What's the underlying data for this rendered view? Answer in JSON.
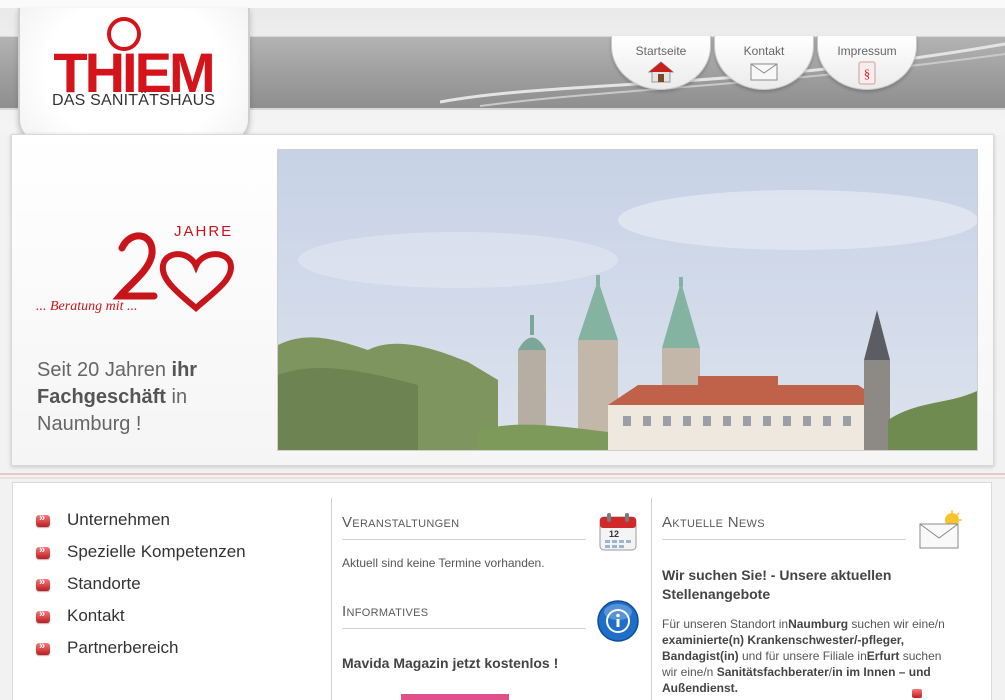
{
  "header": {
    "logo_text": "THIEM",
    "logo_subtitle": "DAS SANITÄTSHAUS",
    "nav": [
      {
        "label": "Startseite",
        "icon": "house-icon"
      },
      {
        "label": "Kontakt",
        "icon": "envelope-icon"
      },
      {
        "label": "Impressum",
        "icon": "paragraph-icon"
      }
    ]
  },
  "hero": {
    "anniversary": {
      "jahre": "JAHRE",
      "number": "20",
      "slogan": "... Beratung mit ..."
    },
    "text_part1": "Seit 20 Jahren ",
    "text_bold1": "ihr Fachgeschäft",
    "text_part2": " in Naumburg !"
  },
  "sidebar": {
    "items": [
      {
        "label": "Unternehmen"
      },
      {
        "label": "Spezielle Kompetenzen"
      },
      {
        "label": "Standorte"
      },
      {
        "label": "Kontakt"
      },
      {
        "label": "Partnerbereich"
      }
    ]
  },
  "events": {
    "title": "Veranstaltungen",
    "icon": "calendar-icon",
    "calendar_day": "12",
    "text": "Aktuell sind keine Termine vorhanden."
  },
  "info": {
    "title": "Informatives",
    "icon": "info-icon",
    "headline": "Mavida Magazin jetzt kostenlos !"
  },
  "news": {
    "title": "Aktuelle News",
    "icon": "mail-sun-icon",
    "headline": "Wir suchen Sie! - Unsere aktuellen Stellenangebote",
    "p1": "Für unseren Standort in",
    "b1": "Naumburg",
    "p2": " suchen wir eine/n ",
    "b2": "examinierte(n) Krankenschwester/-pfleger, Bandagist(in)",
    "p3": " und für unsere Filiale in",
    "b3": "Erfurt",
    "p4": " suchen wir eine/n ",
    "b4": "Sanitätsfachberater",
    "p5": "/",
    "b5": "in im Innen – und Außendienst."
  },
  "colors": {
    "brand_red": "#d4131b",
    "text_grey": "#555555"
  }
}
